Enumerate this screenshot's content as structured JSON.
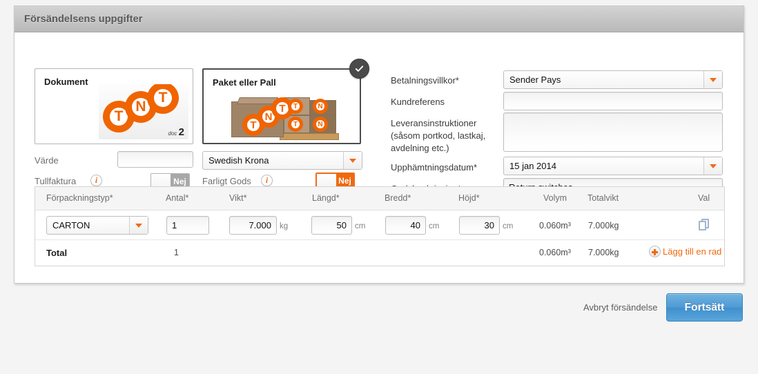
{
  "panel": {
    "title": "Försändelsens uppgifter"
  },
  "shipment_type": {
    "document_card": {
      "title": "Dokument",
      "art": "tnt-document-icon",
      "selected": false,
      "doc_label_prefix": "doc",
      "doc_label_number": "2"
    },
    "package_card": {
      "title": "Paket eller Pall",
      "art": "tnt-boxes-pallet-icon",
      "selected": true,
      "check_glyph": "✓"
    }
  },
  "left_fields": {
    "varde_label": "Värde",
    "varde_value": "",
    "currency_value": "Swedish Krona",
    "tullfaktura_label": "Tullfaktura",
    "tullfaktura_toggle": "Nej",
    "farligt_gods_label": "Farligt Gods",
    "farligt_gods_toggle": "Nej",
    "info_glyph": "i"
  },
  "right_fields": {
    "betalningsvillkor_label": "Betalningsvillkor*",
    "betalningsvillkor_value": "Sender Pays",
    "kundreferens_label": "Kundreferens",
    "kundreferens_value": "",
    "leveransinstruktioner_label_line1": "Leveransinstruktioner",
    "leveransinstruktioner_label_line2": "(såsom portkod, lastkaj,",
    "leveransinstruktioner_label_line3": "avdelning etc.)",
    "leveransinstruktioner_value": "",
    "upphamtningsdatum_label": "Upphämtningsdatum*",
    "upphamtningsdatum_value": "15 jan 2014",
    "godsbeskrivning_label": "Godsbeskrivning*",
    "godsbeskrivning_value": "Return switches"
  },
  "table": {
    "headers": {
      "forpackningstyp": "Förpackningstyp*",
      "antal": "Antal*",
      "vikt": "Vikt*",
      "langd": "Längd*",
      "bredd": "Bredd*",
      "hojd": "Höjd*",
      "volym": "Volym",
      "totalvikt": "Totalvikt",
      "val": "Val"
    },
    "row": {
      "forpackningstyp": "CARTON",
      "antal": "1",
      "vikt": "7.000",
      "vikt_unit": "kg",
      "langd": "50",
      "langd_unit": "cm",
      "bredd": "40",
      "bredd_unit": "cm",
      "hojd": "30",
      "hojd_unit": "cm",
      "volym": "0.060m³",
      "totalvikt": "7.000kg",
      "copy_icon": "duplicate-row-icon"
    },
    "total": {
      "label": "Total",
      "antal": "1",
      "volym": "0.060m³",
      "totalvikt": "7.000kg",
      "add_row_label": "Lägg till en rad"
    }
  },
  "footer": {
    "cancel_label": "Avbryt försändelse",
    "continue_label": "Fortsätt"
  },
  "colors": {
    "accent_orange": "#f0690f",
    "primary_blue": "#4f9ad4",
    "panel_header": "#c6c6c6"
  }
}
